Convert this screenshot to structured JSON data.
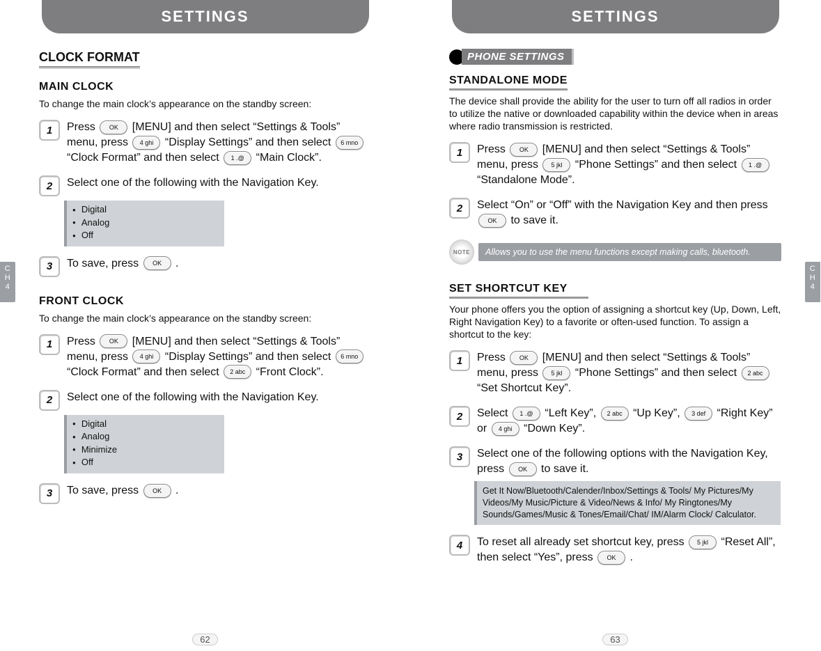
{
  "header": {
    "title": "SETTINGS"
  },
  "chapter": {
    "ch": "C",
    "h": "H",
    "num": "4"
  },
  "keys": {
    "ok": "OK",
    "k1": "1 .@",
    "k2": "2 abc",
    "k3": "3 def",
    "k4": "4 ghi",
    "k5": "5 jkl",
    "k6": "6 mno"
  },
  "left": {
    "pageNum": "62",
    "clockFormat": {
      "title": "CLOCK FORMAT",
      "main": {
        "title": "MAIN CLOCK",
        "desc": "To change the main clock’s appearance on the standby screen:",
        "step1a": "Press ",
        "step1b": " [MENU] and then select “Settings & Tools” menu, press ",
        "step1c": " “Display Settings” and then select ",
        "step1d": " “Clock Format” and then select ",
        "step1e": " “Main Clock”.",
        "step2": "Select one of the following with the Navigation Key.",
        "options": [
          "Digital",
          "Analog",
          "Off"
        ],
        "step3a": "To save, press ",
        "step3b": " ."
      },
      "front": {
        "title": "FRONT CLOCK",
        "desc": "To change the main clock’s appearance on the standby screen:",
        "step1a": "Press ",
        "step1b": " [MENU] and then select “Settings & Tools” menu, press ",
        "step1c": " “Display Settings” and then select ",
        "step1d": " “Clock Format” and then select ",
        "step1e": " “Front Clock”.",
        "step2": "Select one of the following with the Navigation Key.",
        "options": [
          "Digital",
          "Analog",
          "Minimize",
          "Off"
        ],
        "step3a": "To save, press ",
        "step3b": " ."
      }
    }
  },
  "right": {
    "pageNum": "63",
    "phoneSettingsLabel": "PHONE SETTINGS",
    "standalone": {
      "title": "STANDALONE MODE",
      "desc": "The device shall provide the ability for the user to turn off all radios in order to utilize the native or downloaded capability within the device when in areas where radio transmission is restricted.",
      "step1a": "Press ",
      "step1b": " [MENU] and then select “Settings & Tools” menu, press ",
      "step1c": " “Phone Settings” and then select ",
      "step1d": " “Standalone Mode”.",
      "step2a": "Select “On” or “Off” with the Navigation Key and then press ",
      "step2b": " to save it.",
      "note": "Allows you to use the menu functions except making calls, bluetooth."
    },
    "shortcut": {
      "title": "SET SHORTCUT KEY",
      "desc": "Your phone offers you the option of assigning a shortcut key (Up, Down, Left, Right Navigation Key) to a favorite or often-used function. To assign a shortcut to the key:",
      "step1a": "Press ",
      "step1b": " [MENU] and then select “Settings & Tools” menu, press ",
      "step1c": " “Phone Settings” and then select ",
      "step1d": " “Set Shortcut Key”.",
      "step2a": "Select ",
      "step2b": " “Left Key”, ",
      "step2c": " “Up Key”, ",
      "step2d": " “Right Key” or ",
      "step2e": " “Down Key”.",
      "step3a": "Select one of the following options with the Navigation Key, press ",
      "step3b": " to save it.",
      "options": "Get It Now/Bluetooth/Calender/Inbox/Settings & Tools/ My Pictures/My Videos/My Music/Picture & Video/News & Info/ My Ringtones/My Sounds/Games/Music & Tones/Email/Chat/ IM/Alarm Clock/ Calculator.",
      "step4a": "To reset all already set shortcut key, press ",
      "step4b": " “Reset All”, then select “Yes”, press ",
      "step4c": " ."
    }
  }
}
